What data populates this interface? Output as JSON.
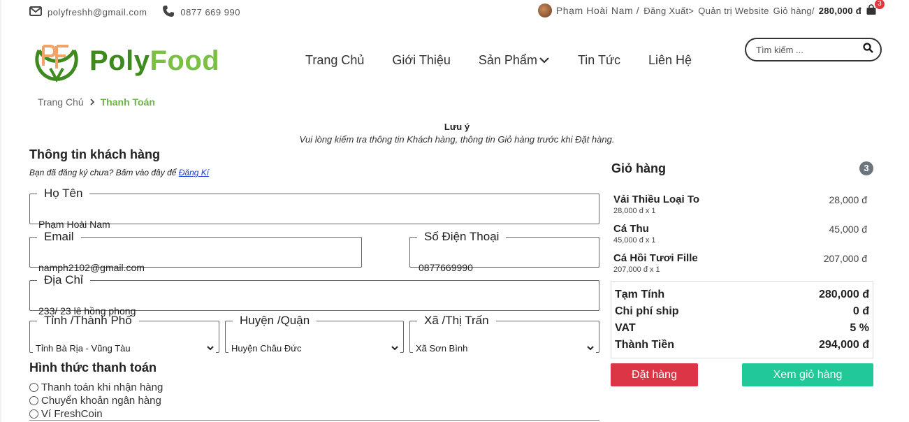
{
  "topbar": {
    "email": "polyfreshh@gmail.com",
    "phone": "0877 669 990",
    "user_name": "Phạm Hoài Nam /",
    "logout": "Đăng Xuất>",
    "admin": "Quản trị Website",
    "cart_label": "Giỏ hàng/",
    "cart_total": "280,000 đ",
    "cart_badge": "3"
  },
  "brand": {
    "poly": "Poly",
    "food": "Food"
  },
  "nav": {
    "items": [
      "Trang Chủ",
      "Giới Thiệu",
      "Sản Phẩm",
      "Tin Tức",
      "Liên Hệ"
    ]
  },
  "search": {
    "placeholder": "Tìm kiếm ..."
  },
  "breadcrumb": {
    "home": "Trang Chủ",
    "current": "Thanh Toán"
  },
  "notice": {
    "title": "Lưu ý",
    "text": "Vui lòng kiểm tra thông tin Khách hàng, thông tin Giỏ hàng trước khi Đặt hàng."
  },
  "customer": {
    "title": "Thông tin khách hàng",
    "register_prompt": "Bạn đã đăng ký chưa? Bấm vào đây để",
    "register_link": "Đăng Kí",
    "name_label": "Họ Tên",
    "name_value": "Phạm Hoài Nam",
    "email_label": "Email",
    "email_value": "namph2102@gmail.com",
    "phone_label": "Số Điện Thoại",
    "phone_value": "0877669990",
    "address_label": "Địa Chỉ",
    "address_value": "233/ 23 lê hồng phong",
    "province_label": "Tỉnh /Thành Phố",
    "province_value": "Tỉnh Bà Rịa - Vũng Tàu",
    "district_label": "Huyện /Quận",
    "district_value": "Huyện Châu Đức",
    "ward_label": "Xã /Thị Trấn",
    "ward_value": "Xã Sơn Bình"
  },
  "payment": {
    "title": "Hình thức thanh toán",
    "options": [
      "Thanh toán khi nhận hàng",
      "Chuyển khoản ngân hàng",
      "Ví FreshCoin"
    ]
  },
  "cart": {
    "title": "Giỏ hàng",
    "count": "3",
    "items": [
      {
        "name": "Vải Thiều Loại To",
        "detail": "28,000 đ x 1",
        "price": "28,000 đ"
      },
      {
        "name": "Cá Thu",
        "detail": "45,000 đ x 1",
        "price": "45,000 đ"
      },
      {
        "name": "Cá Hồi Tươi Fille",
        "detail": "207,000 đ x 1",
        "price": "207,000 đ"
      }
    ],
    "totals": [
      {
        "label": "Tạm Tính",
        "value": "280,000 đ"
      },
      {
        "label": "Chi phí ship",
        "value": "0 đ"
      },
      {
        "label": "VAT",
        "value": "5 %"
      },
      {
        "label": "Thành Tiền",
        "value": "294,000 đ"
      }
    ],
    "order_button": "Đặt hàng",
    "view_cart_button": "Xem giỏ hàng"
  },
  "colors": {
    "brand_dark": "#3e8a1e",
    "brand_light": "#79c043",
    "order_button": "#dc3545",
    "view_button": "#20c997",
    "badge": "#e0383e"
  }
}
